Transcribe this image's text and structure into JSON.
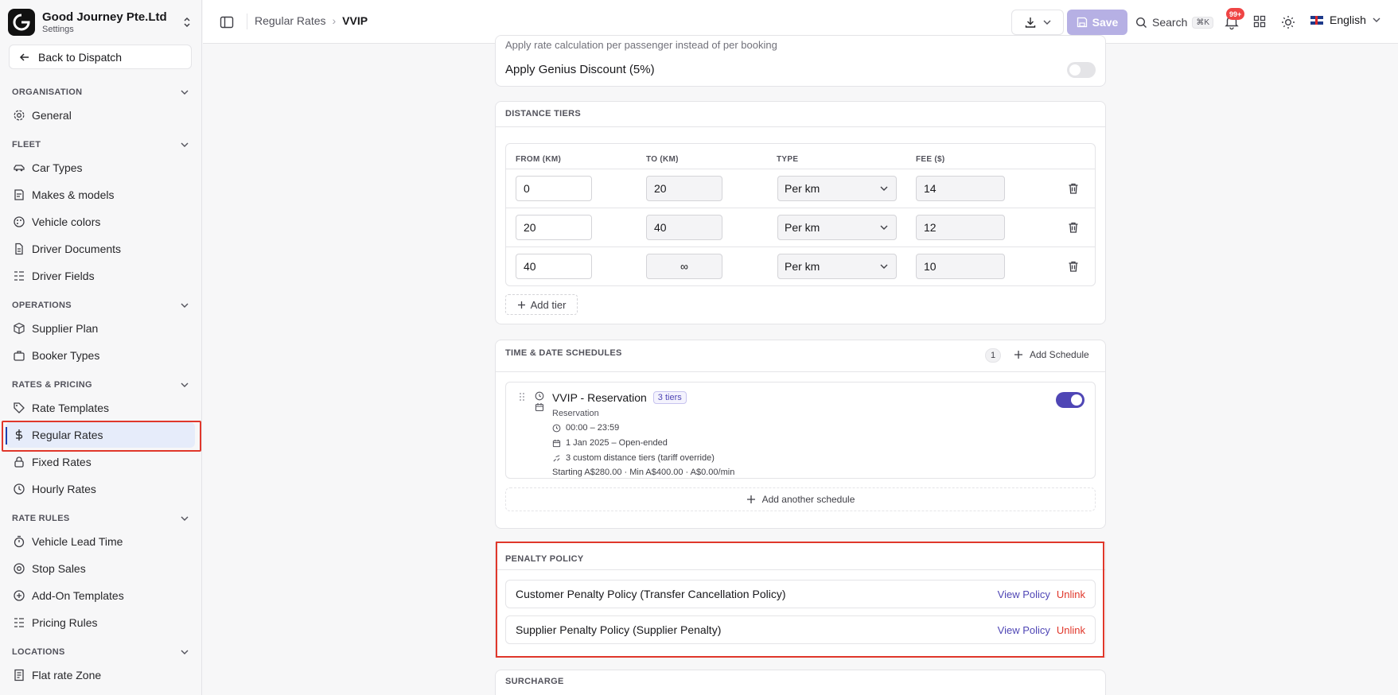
{
  "org": {
    "name": "Good Journey Pte.Ltd",
    "subtitle": "Settings"
  },
  "sidebar": {
    "back_label": "Back to Dispatch",
    "sections": [
      {
        "label": "ORGANISATION",
        "items": [
          {
            "label": "General",
            "icon": "gear-icon"
          }
        ]
      },
      {
        "label": "FLEET",
        "items": [
          {
            "label": "Car Types",
            "icon": "car-icon"
          },
          {
            "label": "Makes & models",
            "icon": "book-icon"
          },
          {
            "label": "Vehicle colors",
            "icon": "palette-icon"
          },
          {
            "label": "Driver Documents",
            "icon": "document-icon"
          },
          {
            "label": "Driver Fields",
            "icon": "list-icon"
          }
        ]
      },
      {
        "label": "OPERATIONS",
        "items": [
          {
            "label": "Supplier Plan",
            "icon": "box-icon"
          },
          {
            "label": "Booker Types",
            "icon": "briefcase-icon"
          }
        ]
      },
      {
        "label": "RATES & PRICING",
        "items": [
          {
            "label": "Rate Templates",
            "icon": "tag-icon"
          },
          {
            "label": "Regular Rates",
            "icon": "dollar-icon"
          },
          {
            "label": "Fixed Rates",
            "icon": "lock-icon"
          },
          {
            "label": "Hourly Rates",
            "icon": "clock-icon"
          }
        ]
      },
      {
        "label": "RATE RULES",
        "items": [
          {
            "label": "Vehicle Lead Time",
            "icon": "timer-icon"
          },
          {
            "label": "Stop Sales",
            "icon": "stop-icon"
          },
          {
            "label": "Add-On Templates",
            "icon": "plus-circle-icon"
          },
          {
            "label": "Pricing Rules",
            "icon": "list-icon"
          }
        ]
      },
      {
        "label": "LOCATIONS",
        "items": [
          {
            "label": "Flat rate Zone",
            "icon": "receipt-icon"
          }
        ]
      }
    ]
  },
  "topbar": {
    "breadcrumb_parent": "Regular Rates",
    "breadcrumb_current": "VVIP",
    "save_label": "Save",
    "search_label": "Search",
    "search_shortcut": "⌘K",
    "notification_count": "99+",
    "language": "English"
  },
  "options": {
    "per_passenger_hint": "Apply rate calculation per passenger instead of per booking",
    "genius_label": "Apply Genius Discount (5%)",
    "genius_enabled": false
  },
  "distance_tiers": {
    "title": "DISTANCE TIERS",
    "headers": {
      "from": "FROM (KM)",
      "to": "TO (KM)",
      "type": "TYPE",
      "fee": "FEE ($)"
    },
    "rows": [
      {
        "from": "0",
        "to": "20",
        "type": "Per km",
        "fee": "14"
      },
      {
        "from": "20",
        "to": "40",
        "type": "Per km",
        "fee": "12"
      },
      {
        "from": "40",
        "to": "∞",
        "type": "Per km",
        "fee": "10"
      }
    ],
    "add_label": "Add tier"
  },
  "schedules": {
    "title": "TIME & DATE SCHEDULES",
    "count": "1",
    "add_label": "Add Schedule",
    "item": {
      "name": "VVIP - Reservation",
      "badge": "3 tiers",
      "type": "Reservation",
      "time": "00:00 – 23:59",
      "dates": "1 Jan 2025 – Open-ended",
      "tiers_note": "3 custom distance tiers (tariff override)",
      "pricing": "Starting A$280.00 · Min A$400.00 · A$0.00/min",
      "enabled": true
    },
    "add_another_label": "Add another schedule"
  },
  "penalty_policy": {
    "title": "PENALTY POLICY",
    "rows": [
      {
        "label": "Customer Penalty Policy (Transfer Cancellation Policy)",
        "view": "View Policy",
        "unlink": "Unlink"
      },
      {
        "label": "Supplier Penalty Policy (Supplier Penalty)",
        "view": "View Policy",
        "unlink": "Unlink"
      }
    ]
  },
  "surcharge": {
    "title": "SURCHARGE"
  },
  "colors": {
    "accent": "#4f46b5",
    "danger": "#e0372b",
    "active_bg": "#e6ecfa"
  }
}
